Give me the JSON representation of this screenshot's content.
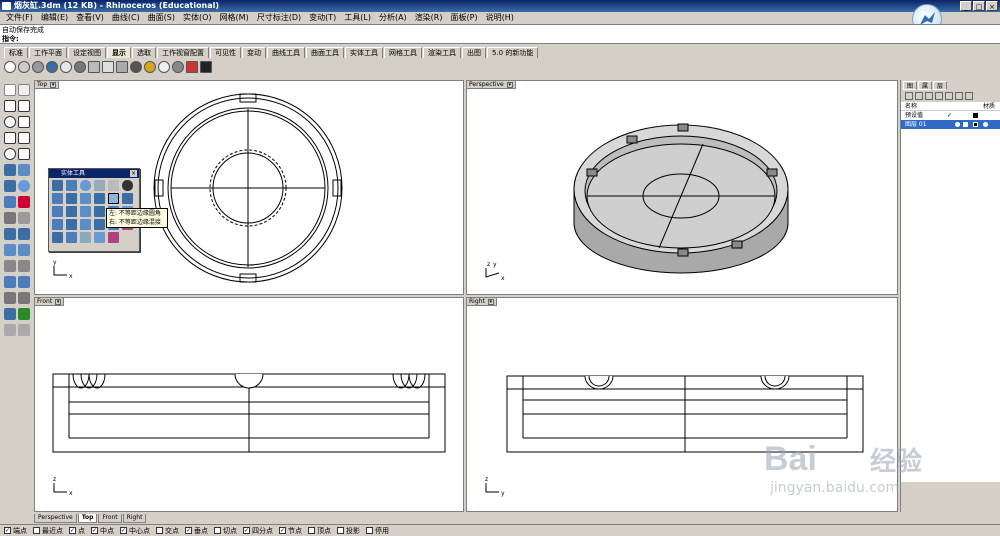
{
  "window": {
    "title": "烟灰缸.3dm (12 KB) - Rhinoceros (Educational)",
    "controls": [
      "_",
      "□",
      "×"
    ]
  },
  "menu": [
    "文件(F)",
    "编辑(E)",
    "查看(V)",
    "曲线(C)",
    "曲面(S)",
    "实体(O)",
    "网格(M)",
    "尺寸标注(D)",
    "变动(T)",
    "工具(L)",
    "分析(A)",
    "渲染(R)",
    "面板(P)",
    "说明(H)"
  ],
  "command": {
    "history": "自动保存完成",
    "prompt": "指令:"
  },
  "tabs": [
    "标准",
    "工作平面",
    "设定视图",
    "显示",
    "选取",
    "工作视窗配置",
    "可见性",
    "变动",
    "曲线工具",
    "曲面工具",
    "实体工具",
    "网格工具",
    "渲染工具",
    "出图",
    "5.0 的新功能"
  ],
  "active_tab": "显示",
  "viewports": {
    "top": {
      "label": "Top",
      "axis_x": "x",
      "axis_y": "y"
    },
    "perspective": {
      "label": "Perspective",
      "axis_x": "x",
      "axis_y": "y",
      "axis_z": "z"
    },
    "front": {
      "label": "Front",
      "axis_x": "x",
      "axis_y": "z"
    },
    "right": {
      "label": "Right",
      "axis_x": "y",
      "axis_y": "z"
    }
  },
  "floating_toolbar": {
    "title": "实体工具"
  },
  "tooltip": {
    "line1": "左: 不等距边缘圆角",
    "line2": "右: 不等距边缘混接"
  },
  "layers": {
    "tabs": [
      "图",
      "属",
      "层"
    ],
    "header": {
      "name": "名称",
      "material": "材质"
    },
    "rows": [
      {
        "name": "预设值",
        "check": "✓",
        "selected": false
      },
      {
        "name": "图层 01",
        "check": "",
        "selected": true
      }
    ]
  },
  "viewport_tabs": [
    "Perspective",
    "Top",
    "Front",
    "Right"
  ],
  "active_viewport_tab": "Top",
  "osnaps": [
    {
      "label": "端点",
      "checked": true
    },
    {
      "label": "最近点",
      "checked": false
    },
    {
      "label": "点",
      "checked": true
    },
    {
      "label": "中点",
      "checked": true
    },
    {
      "label": "中心点",
      "checked": true
    },
    {
      "label": "交点",
      "checked": false
    },
    {
      "label": "垂点",
      "checked": true
    },
    {
      "label": "切点",
      "checked": false
    },
    {
      "label": "四分点",
      "checked": true
    },
    {
      "label": "节点",
      "checked": true
    },
    {
      "label": "顶点",
      "checked": false
    },
    {
      "label": "投影",
      "checked": false
    },
    {
      "label": "停用",
      "checked": false
    }
  ],
  "watermark": {
    "brand": "Bai",
    "brand_cn": "经验",
    "url": "jingyan.baidu.com"
  },
  "colors": {
    "selection": "#316ac5",
    "titlebar": "#0a246a",
    "tooltip_bg": "#ffffe1"
  }
}
